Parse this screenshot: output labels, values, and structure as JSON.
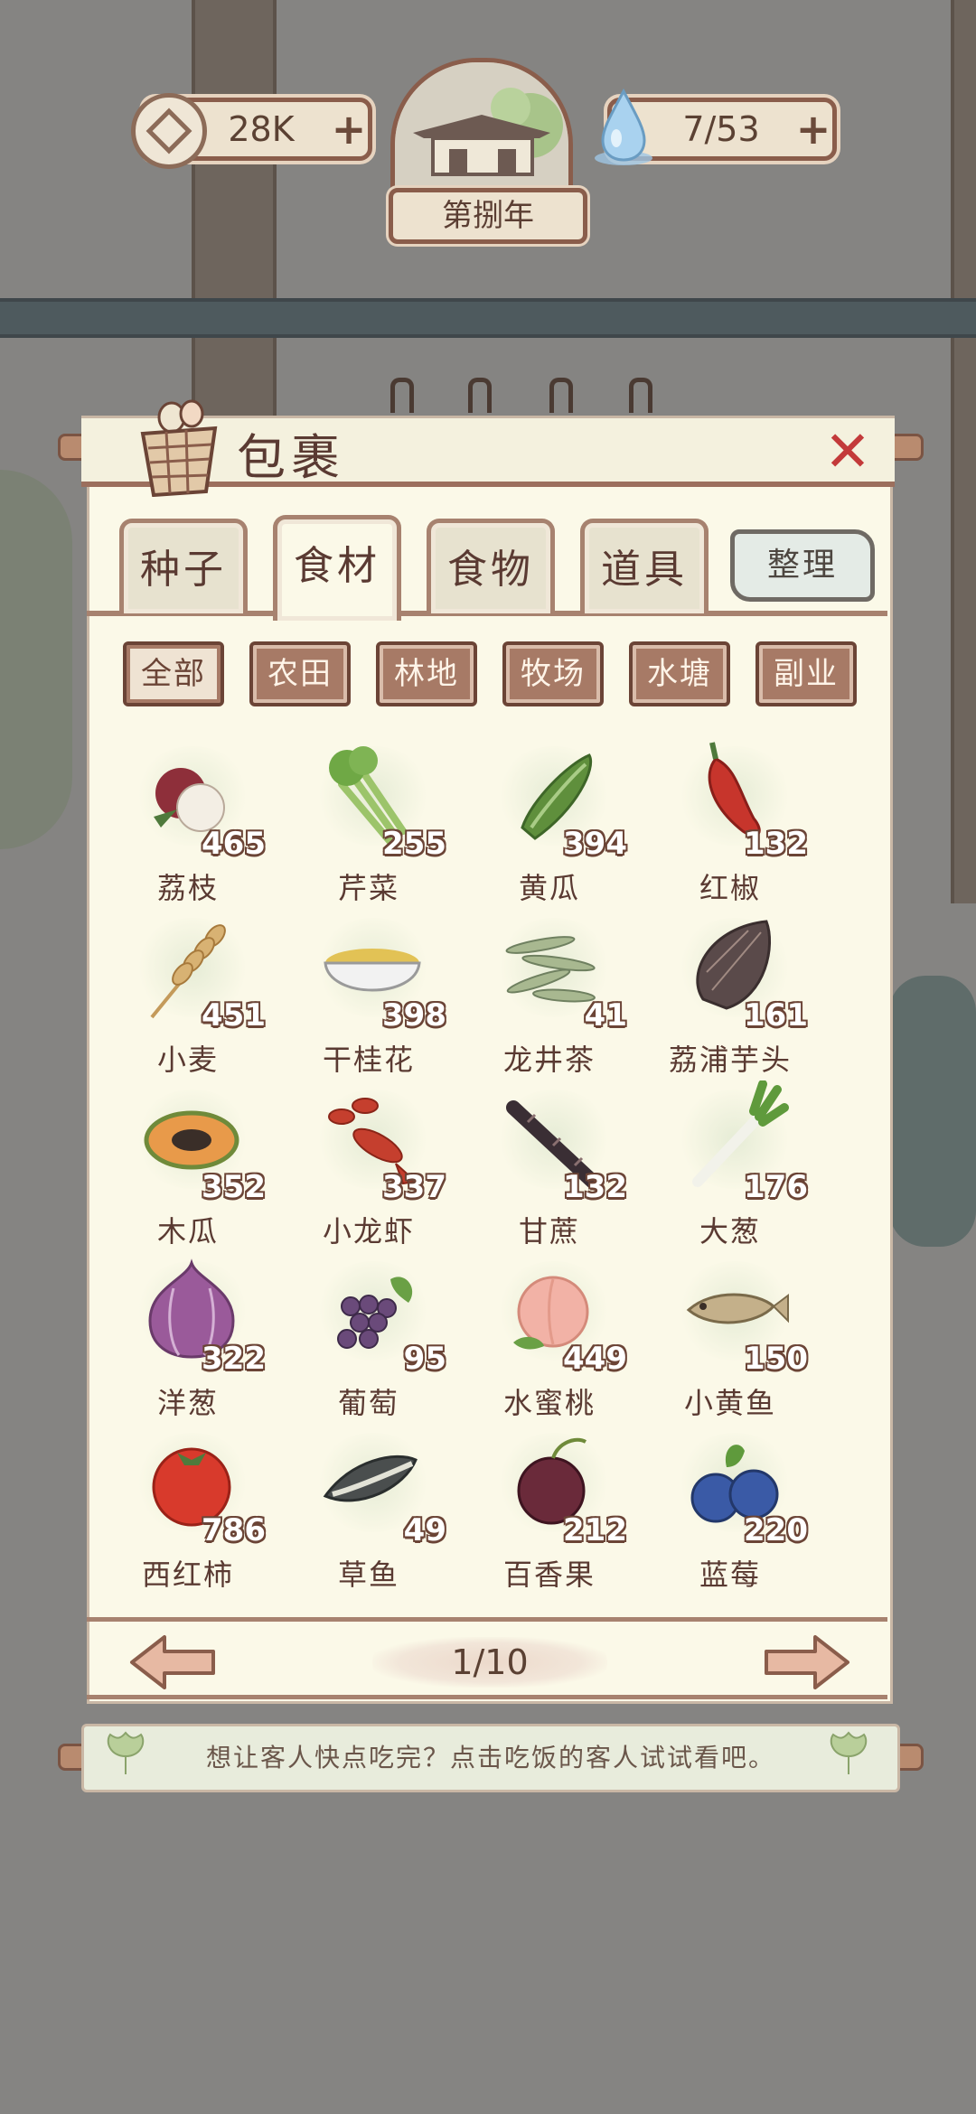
{
  "topbar": {
    "coins": "28K",
    "coins_plus": "+",
    "energy": "7/53",
    "energy_plus": "+",
    "year": "第捌年"
  },
  "panel": {
    "title": "包裹",
    "close": "✕"
  },
  "tabs": [
    {
      "label": "种子",
      "active": false
    },
    {
      "label": "食材",
      "active": true
    },
    {
      "label": "食物",
      "active": false
    },
    {
      "label": "道具",
      "active": false
    }
  ],
  "sort_button": "整理",
  "filters": [
    {
      "label": "全部",
      "active": true
    },
    {
      "label": "农田",
      "active": false
    },
    {
      "label": "林地",
      "active": false
    },
    {
      "label": "牧场",
      "active": false
    },
    {
      "label": "水塘",
      "active": false
    },
    {
      "label": "副业",
      "active": false
    }
  ],
  "items": [
    {
      "name": "荔枝",
      "count": "465",
      "icon": "lychee-icon"
    },
    {
      "name": "芹菜",
      "count": "255",
      "icon": "celery-icon"
    },
    {
      "name": "黄瓜",
      "count": "394",
      "icon": "cucumber-icon"
    },
    {
      "name": "红椒",
      "count": "132",
      "icon": "red-pepper-icon"
    },
    {
      "name": "小麦",
      "count": "451",
      "icon": "wheat-icon"
    },
    {
      "name": "干桂花",
      "count": "398",
      "icon": "dried-osmanthus-icon"
    },
    {
      "name": "龙井茶",
      "count": "41",
      "icon": "longjing-tea-icon"
    },
    {
      "name": "荔浦芋头",
      "count": "161",
      "icon": "taro-icon"
    },
    {
      "name": "木瓜",
      "count": "352",
      "icon": "papaya-icon"
    },
    {
      "name": "小龙虾",
      "count": "337",
      "icon": "crayfish-icon"
    },
    {
      "name": "甘蔗",
      "count": "132",
      "icon": "sugarcane-icon"
    },
    {
      "name": "大葱",
      "count": "176",
      "icon": "scallion-icon"
    },
    {
      "name": "洋葱",
      "count": "322",
      "icon": "onion-icon"
    },
    {
      "name": "葡萄",
      "count": "95",
      "icon": "grape-icon"
    },
    {
      "name": "水蜜桃",
      "count": "449",
      "icon": "peach-icon"
    },
    {
      "name": "小黄鱼",
      "count": "150",
      "icon": "yellow-croaker-icon"
    },
    {
      "name": "西红柿",
      "count": "786",
      "icon": "tomato-icon"
    },
    {
      "name": "草鱼",
      "count": "49",
      "icon": "grass-carp-icon"
    },
    {
      "name": "百香果",
      "count": "212",
      "icon": "passion-fruit-icon"
    },
    {
      "name": "蓝莓",
      "count": "220",
      "icon": "blueberry-icon"
    }
  ],
  "pager": {
    "text": "1/10"
  },
  "hint": "想让客人快点吃完？点击吃饭的客人试试看吧。"
}
